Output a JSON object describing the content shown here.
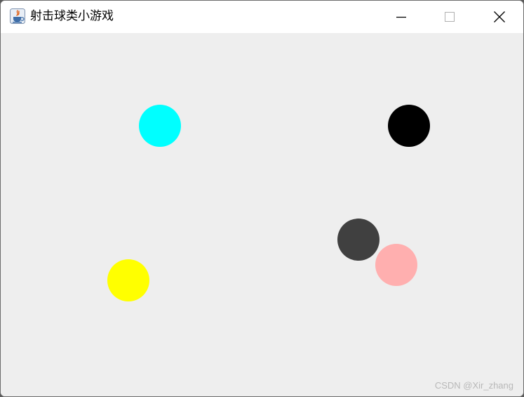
{
  "window": {
    "title": "射击球类小游戏",
    "app_icon": "java-coffee-icon",
    "controls": {
      "minimize_icon": "minimize-icon",
      "maximize_icon": "maximize-icon",
      "close_icon": "close-icon"
    }
  },
  "game": {
    "background_color": "#eeeeee",
    "balls": [
      {
        "color": "#00ffff"
      },
      {
        "color": "#000000"
      },
      {
        "color": "#404040"
      },
      {
        "color": "#ffafaf"
      },
      {
        "color": "#ffff00"
      }
    ]
  },
  "watermark": "CSDN @Xir_zhang"
}
